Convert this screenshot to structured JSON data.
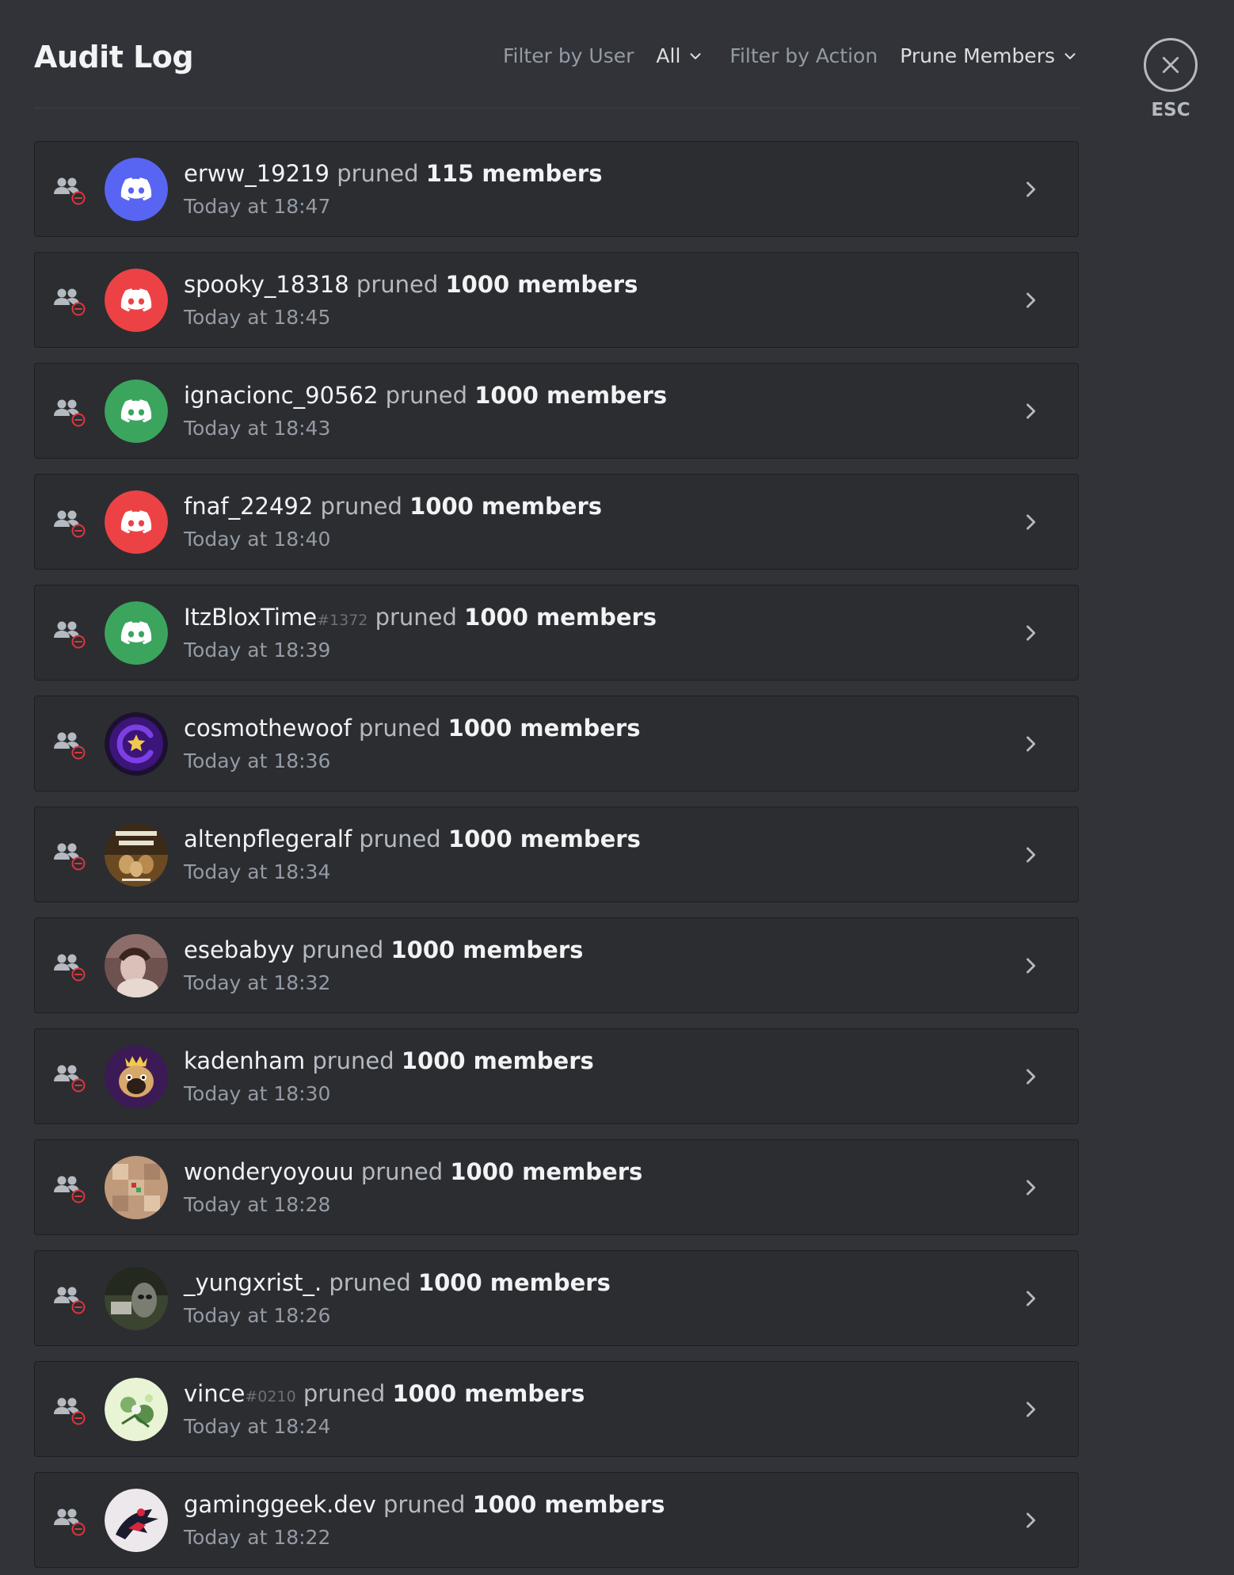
{
  "header": {
    "title": "Audit Log",
    "filter_user_label": "Filter by User",
    "filter_user_value": "All",
    "filter_action_label": "Filter by Action",
    "filter_action_value": "Prune Members",
    "esc_label": "ESC"
  },
  "entries": [
    {
      "user": "erww_19219",
      "disc": "",
      "verb": "pruned",
      "count": "115 members",
      "time": "Today at 18:47",
      "avatar": "discord-blurple"
    },
    {
      "user": "spooky_18318",
      "disc": "",
      "verb": "pruned",
      "count": "1000 members",
      "time": "Today at 18:45",
      "avatar": "discord-red"
    },
    {
      "user": "ignacionc_90562",
      "disc": "",
      "verb": "pruned",
      "count": "1000 members",
      "time": "Today at 18:43",
      "avatar": "discord-green"
    },
    {
      "user": "fnaf_22492",
      "disc": "",
      "verb": "pruned",
      "count": "1000 members",
      "time": "Today at 18:40",
      "avatar": "discord-red"
    },
    {
      "user": "ItzBloxTime",
      "disc": "#1372",
      "verb": "pruned",
      "count": "1000 members",
      "time": "Today at 18:39",
      "avatar": "discord-green"
    },
    {
      "user": "cosmothewoof",
      "disc": "",
      "verb": "pruned",
      "count": "1000 members",
      "time": "Today at 18:36",
      "avatar": "star-purple"
    },
    {
      "user": "altenpflegeralf",
      "disc": "",
      "verb": "pruned",
      "count": "1000 members",
      "time": "Today at 18:34",
      "avatar": "meme-photo"
    },
    {
      "user": "esebabyy",
      "disc": "",
      "verb": "pruned",
      "count": "1000 members",
      "time": "Today at 18:32",
      "avatar": "portrait-photo"
    },
    {
      "user": "kadenham",
      "disc": "",
      "verb": "pruned",
      "count": "1000 members",
      "time": "Today at 18:30",
      "avatar": "pug-king"
    },
    {
      "user": "wonderyoyouu",
      "disc": "",
      "verb": "pruned",
      "count": "1000 members",
      "time": "Today at 18:28",
      "avatar": "pixel-block"
    },
    {
      "user": "_yungxrist_.",
      "disc": "",
      "verb": "pruned",
      "count": "1000 members",
      "time": "Today at 18:26",
      "avatar": "dark-photo"
    },
    {
      "user": "vince",
      "disc": "#0210",
      "verb": "pruned",
      "count": "1000 members",
      "time": "Today at 18:24",
      "avatar": "floral-light"
    },
    {
      "user": "gaminggeek.dev",
      "disc": "",
      "verb": "pruned",
      "count": "1000 members",
      "time": "Today at 18:22",
      "avatar": "spider-hero"
    }
  ],
  "colors": {
    "background": "#313338",
    "row_background": "#2b2d31",
    "prune_icon_red": "#da373c",
    "discord_blurple": "#5865f2",
    "discord_red": "#ed4245",
    "discord_green": "#3ba55d"
  },
  "icons": {
    "row_action": "members-prune-icon",
    "row_open": "chevron-right-icon",
    "dropdown": "chevron-down-icon",
    "close": "close-icon"
  }
}
